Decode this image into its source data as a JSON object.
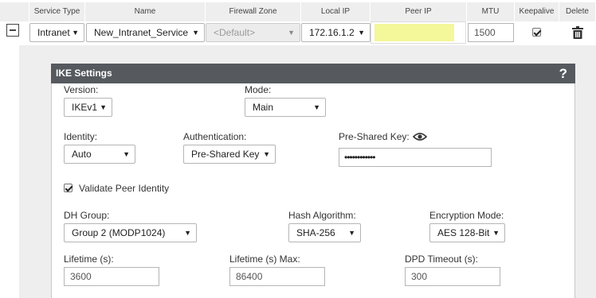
{
  "table": {
    "headers": {
      "service_type": "Service Type",
      "name": "Name",
      "firewall_zone": "Firewall Zone",
      "local_ip": "Local IP",
      "peer_ip": "Peer IP",
      "mtu": "MTU",
      "keepalive": "Keepalive",
      "delete": "Delete"
    },
    "row": {
      "service_type": "Intranet",
      "name": "New_Intranet_Service",
      "firewall_zone": "<Default>",
      "local_ip": "172.16.1.2",
      "peer_ip": "",
      "mtu": "1500",
      "keepalive": true
    }
  },
  "ike": {
    "title": "IKE Settings",
    "help": "?",
    "version_label": "Version:",
    "version_value": "IKEv1",
    "mode_label": "Mode:",
    "mode_value": "Main",
    "identity_label": "Identity:",
    "identity_value": "Auto",
    "auth_label": "Authentication:",
    "auth_value": "Pre-Shared Key",
    "psk_label": "Pre-Shared Key:",
    "psk_value": "••••••••••••",
    "validate_label": "Validate Peer Identity",
    "validate_checked": true,
    "dh_label": "DH Group:",
    "dh_value": "Group 2 (MODP1024)",
    "hash_label": "Hash Algorithm:",
    "hash_value": "SHA-256",
    "enc_label": "Encryption Mode:",
    "enc_value": "AES 128-Bit",
    "lifetime_label": "Lifetime (s):",
    "lifetime_value": "3600",
    "lifetime_max_label": "Lifetime (s) Max:",
    "lifetime_max_value": "86400",
    "dpd_label": "DPD Timeout (s):",
    "dpd_value": "300"
  },
  "icons": {
    "collapse": "minus-square-icon",
    "trash": "trash-icon",
    "eye": "eye-icon",
    "dropdown": "caret-down-icon"
  },
  "colors": {
    "title_bar": "#565a5f",
    "peer_ip_highlight": "#f4f79a",
    "panel_bg": "#eeeeee"
  }
}
